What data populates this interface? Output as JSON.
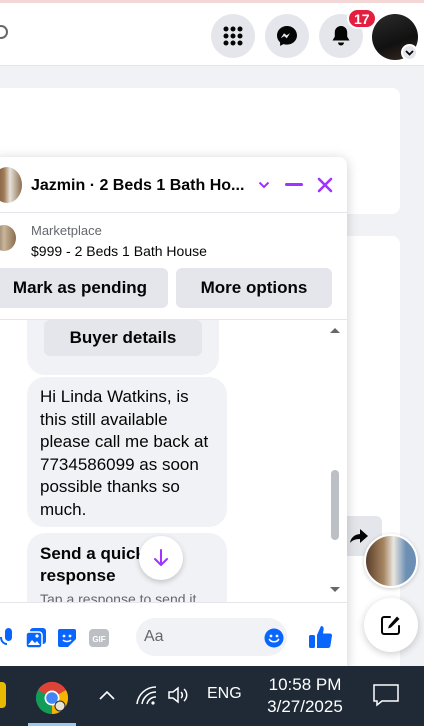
{
  "topnav": {
    "notification_count": "17"
  },
  "chat": {
    "title": "Jazmin · 2 Beds 1 Bath Ho...",
    "marketplace_label": "Marketplace",
    "listing_title": "$999 - 2 Beds 1 Bath House",
    "mark_pending_label": "Mark as pending",
    "more_options_label": "More options",
    "buyer_details_label": "Buyer details",
    "message_lines": [
      "Hi Linda Watkins, is",
      "this still available",
      "please call me back at",
      "7734586099 as soon",
      "possible thanks so",
      "much."
    ],
    "quick_title": "Send a quick response",
    "quick_subtitle": "Tap a response to send it",
    "input_placeholder": "Aa",
    "accent_color": "#a033ff"
  },
  "taskbar": {
    "language": "ENG",
    "time": "10:58 PM",
    "date": "3/27/2025"
  }
}
